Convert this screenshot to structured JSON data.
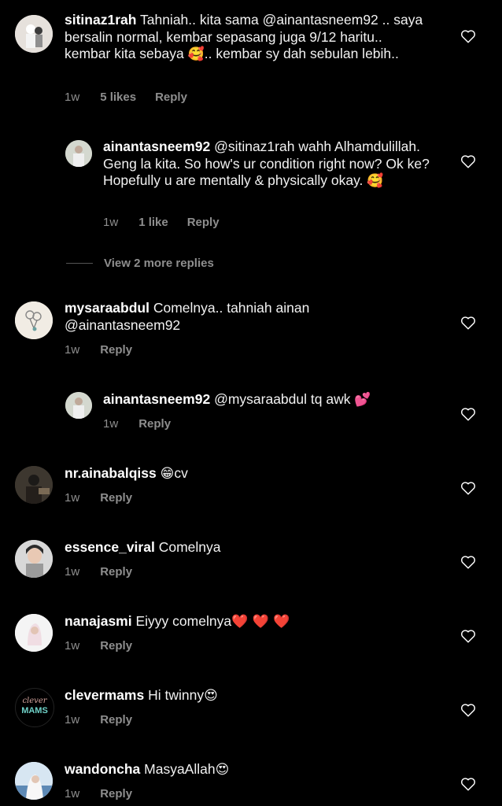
{
  "comments": [
    {
      "username": "sitinaz1rah",
      "text": "Tahniah.. kita sama @ainantasneem92 .. saya bersalin normal, kembar sepasang juga 9/12 haritu.. kembar kita sebaya",
      "emoji": "🥰",
      "text_after": ".. kembar sy dah sebulan lebih..",
      "time": "1w",
      "likes": "5 likes",
      "reply": "Reply"
    },
    {
      "username": "ainantasneem92",
      "text": "@sitinaz1rah wahh Alhamdulillah. Geng la kita. So how's ur condition right now? Ok ke? Hopefully u are mentally & physically okay.",
      "emoji": "🥰",
      "time": "1w",
      "likes": "1 like",
      "reply": "Reply"
    },
    {
      "username": "mysaraabdul",
      "text": "Comelnya.. tahniah ainan @ainantasneem92",
      "time": "1w",
      "reply": "Reply"
    },
    {
      "username": "ainantasneem92",
      "text": "@mysaraabdul tq awk",
      "emoji": "💕",
      "time": "1w",
      "reply": "Reply"
    },
    {
      "username": "nr.ainabalqiss",
      "emoji": "😁",
      "text": "cv",
      "time": "1w",
      "reply": "Reply"
    },
    {
      "username": "essence_viral",
      "text": "Comelnya",
      "time": "1w",
      "reply": "Reply"
    },
    {
      "username": "nanajasmi",
      "text": "Eiyyy comelnya",
      "emoji": "❤️ ❤️ ❤️",
      "time": "1w",
      "reply": "Reply"
    },
    {
      "username": "clevermams",
      "text": "Hi twinny",
      "emoji": "😍",
      "time": "1w",
      "reply": "Reply",
      "avatar_text_1": "clever",
      "avatar_text_2": "MAMS"
    },
    {
      "username": "wandoncha",
      "text": "MasyaAllah",
      "emoji": "😍",
      "time": "1w",
      "reply": "Reply"
    }
  ],
  "view_more": "View 2 more replies",
  "colors": {
    "background": "#000000",
    "meta": "#8e8e8e",
    "heart_red": "#e0323c"
  },
  "icons": {
    "like": "heart-outline-icon"
  }
}
